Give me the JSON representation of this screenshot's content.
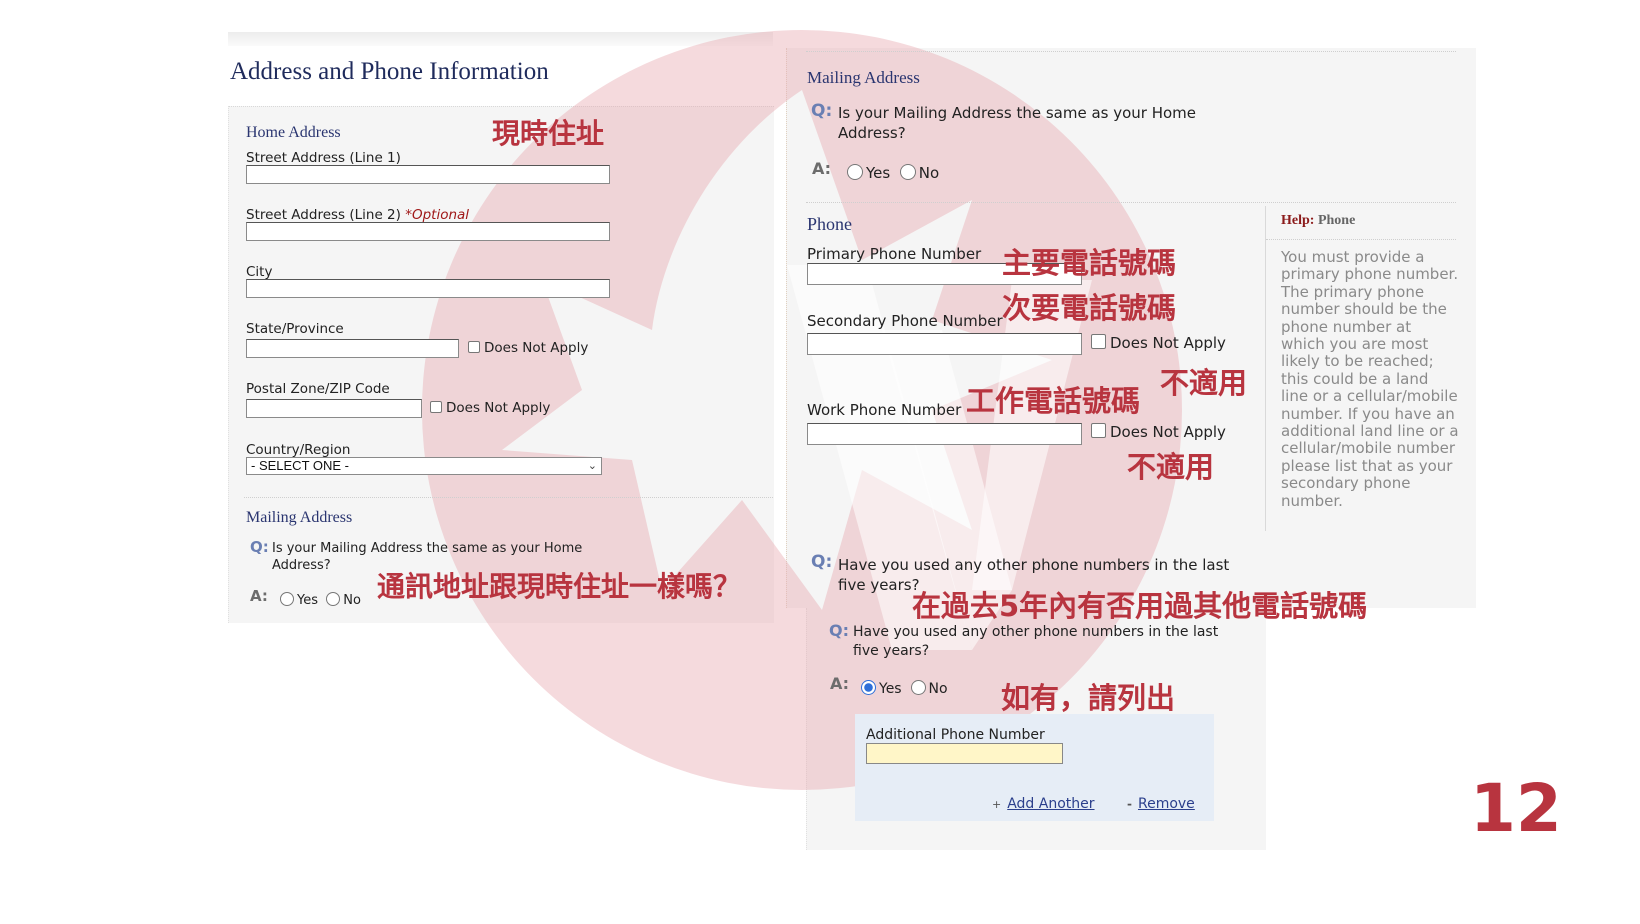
{
  "page_title": "Address and Phone Information",
  "page_number": "12",
  "home_address": {
    "heading": "Home Address",
    "annotation": "現時住址",
    "street1_label": "Street Address (Line 1)",
    "street1_value": "",
    "street2_label": "Street Address (Line 2)",
    "street2_optional": "*Optional",
    "street2_value": "",
    "city_label": "City",
    "city_value": "",
    "state_label": "State/Province",
    "state_value": "",
    "state_dna": "Does Not Apply",
    "zip_label": "Postal Zone/ZIP Code",
    "zip_value": "",
    "zip_dna": "Does Not Apply",
    "country_label": "Country/Region",
    "country_selected": "- SELECT ONE -"
  },
  "mailing_left": {
    "heading": "Mailing Address",
    "q_marker": "Q:",
    "question": "Is your Mailing Address the same as your Home Address?",
    "a_marker": "A:",
    "yes": "Yes",
    "no": "No",
    "annotation": "通訊地址跟現時住址一樣嗎？"
  },
  "mailing_right": {
    "heading": "Mailing Address",
    "q_marker": "Q:",
    "question": "Is your Mailing Address the same as your Home Address?",
    "a_marker": "A:",
    "yes": "Yes",
    "no": "No"
  },
  "phone": {
    "heading": "Phone",
    "primary_label": "Primary Phone Number",
    "primary_value": "",
    "primary_annotation": "主要電話號碼",
    "secondary_label": "Secondary Phone Number",
    "secondary_value": "",
    "secondary_annotation": "次要電話號碼",
    "secondary_dna": "Does Not Apply",
    "secondary_dna_annotation": "不適用",
    "work_label": "Work Phone Number",
    "work_value": "",
    "work_annotation": "工作電話號碼",
    "work_dna": "Does Not Apply",
    "work_dna_annotation": "不適用"
  },
  "help": {
    "prefix": "Help:",
    "topic": "Phone",
    "text": "You must provide a primary phone number. The primary phone number should be the phone number at which you are most likely to be reached; this could be a land line or a cellular/mobile number. If you have an additional land line or a cellular/mobile number please list that as your secondary phone number."
  },
  "other_numbers_upper": {
    "q_marker": "Q:",
    "question": "Have you used any other phone numbers in the last five years?",
    "annotation": "在過去5年內有否用過其他電話號碼"
  },
  "other_numbers_lower": {
    "q_marker": "Q:",
    "question": "Have you used any other phone numbers in the last five years?",
    "a_marker": "A:",
    "yes": "Yes",
    "no": "No",
    "selected": "Yes",
    "annotation": "如有，請列出",
    "additional_label": "Additional Phone Number",
    "additional_value": "",
    "add_another": "Add Another",
    "remove": "Remove"
  },
  "colors": {
    "annotation_red": "#b8343f",
    "heading_navy": "#1f2b5c",
    "help_red": "#8b1a1a",
    "radio_blue": "#2f6fd8",
    "panel_bg": "#f5f5f5",
    "highlight_input": "#fff7c6"
  }
}
